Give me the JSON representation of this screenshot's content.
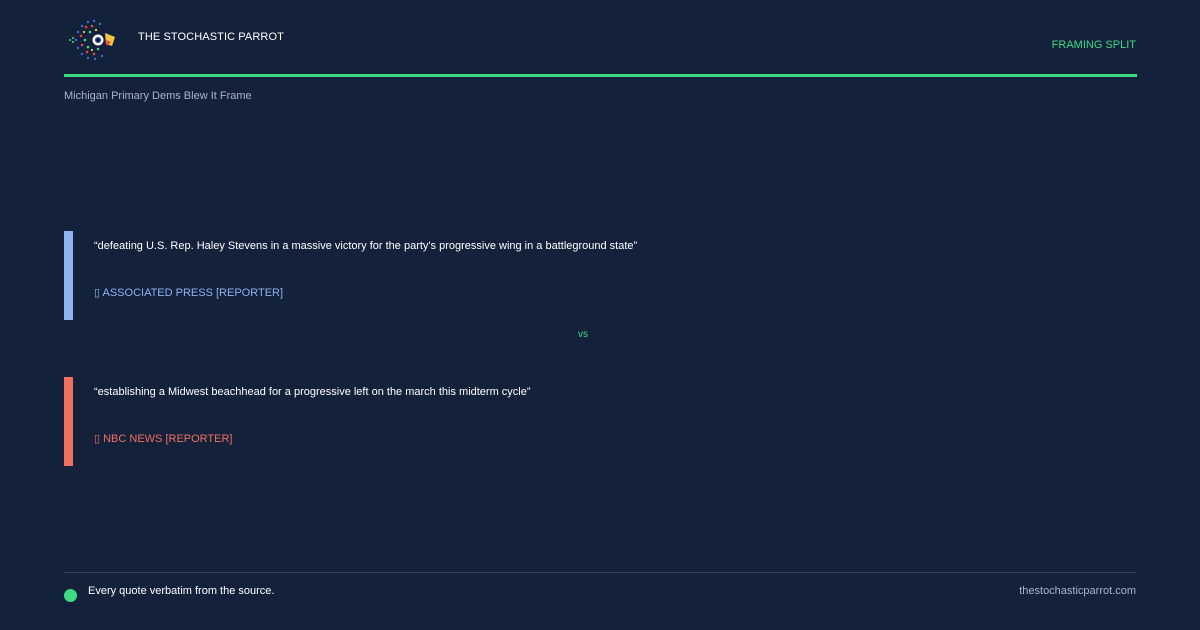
{
  "brand": {
    "name": "THE STOCHASTIC PARROT"
  },
  "header": {
    "tag": "FRAMING SPLIT"
  },
  "subtitle": "Michigan Primary Dems Blew It Frame",
  "quotes": [
    {
      "text": "“defeating U.S. Rep. Haley Stevens in a massive victory for the party's progressive wing in a battleground state”",
      "source": "▯ ASSOCIATED PRESS [REPORTER]",
      "color": "#8fb3f2"
    },
    {
      "text": "“establishing a Midwest beachhead for a progressive left on the march this midterm cycle”",
      "source": "▯ NBC NEWS [REPORTER]",
      "color": "#f0705e"
    }
  ],
  "vs_label": "vs",
  "footer": {
    "note": "Every quote verbatim from the source.",
    "site": "thestochasticparrot.com"
  },
  "colors": {
    "background": "#13213b",
    "accent": "#3ddc84",
    "muted": "#a9b4c6"
  },
  "icons": {
    "logo": "parrot-logo-icon"
  }
}
